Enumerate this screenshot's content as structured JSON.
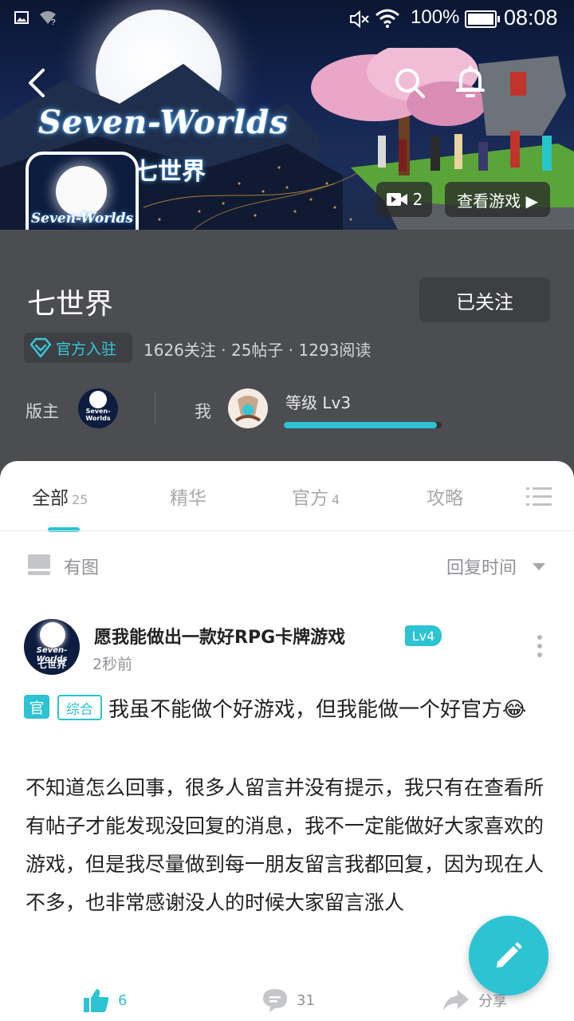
{
  "status_bar": {
    "battery": "100%",
    "time": "08:08"
  },
  "banner": {
    "logo_title": "Seven-Worlds",
    "logo_subtitle": "七世界",
    "video_count": "2",
    "view_game_label": "查看游戏 ▶"
  },
  "forum": {
    "name": "七世界",
    "follow_label": "已关注",
    "official_badge": "官方入驻",
    "stats": "1626关注 · 25帖子 · 1293阅读",
    "moderator_label": "版主",
    "me_label": "我",
    "level_label": "等级 Lv3",
    "level_progress": 0.97
  },
  "tabs": [
    {
      "label": "全部",
      "count": "25"
    },
    {
      "label": "精华",
      "count": ""
    },
    {
      "label": "官方",
      "count": "4"
    },
    {
      "label": "攻略",
      "count": ""
    }
  ],
  "filter": {
    "label": "有图",
    "sort_label": "回复时间"
  },
  "post": {
    "author": "愿我能做出一款好RPG卡牌游戏",
    "level": "Lv4",
    "time": "2秒前",
    "tag_official": "官",
    "tag_category": "综合",
    "title": "我虽不能做个好游戏，但我能做一个好官方😂",
    "body": "不知道怎么回事，很多人留言并没有提示，我只有在查看所有帖子才能发现没回复的消息，我不一定能做好大家喜欢的游戏，但是我尽量做到每一朋友留言我都回复，因为现在人不多，也非常感谢没人的时候大家留言涨人",
    "likes": "6",
    "comments": "31",
    "share_label": "分享"
  },
  "colors": {
    "accent": "#2cc3d3",
    "info_bg": "#4b4d51"
  }
}
